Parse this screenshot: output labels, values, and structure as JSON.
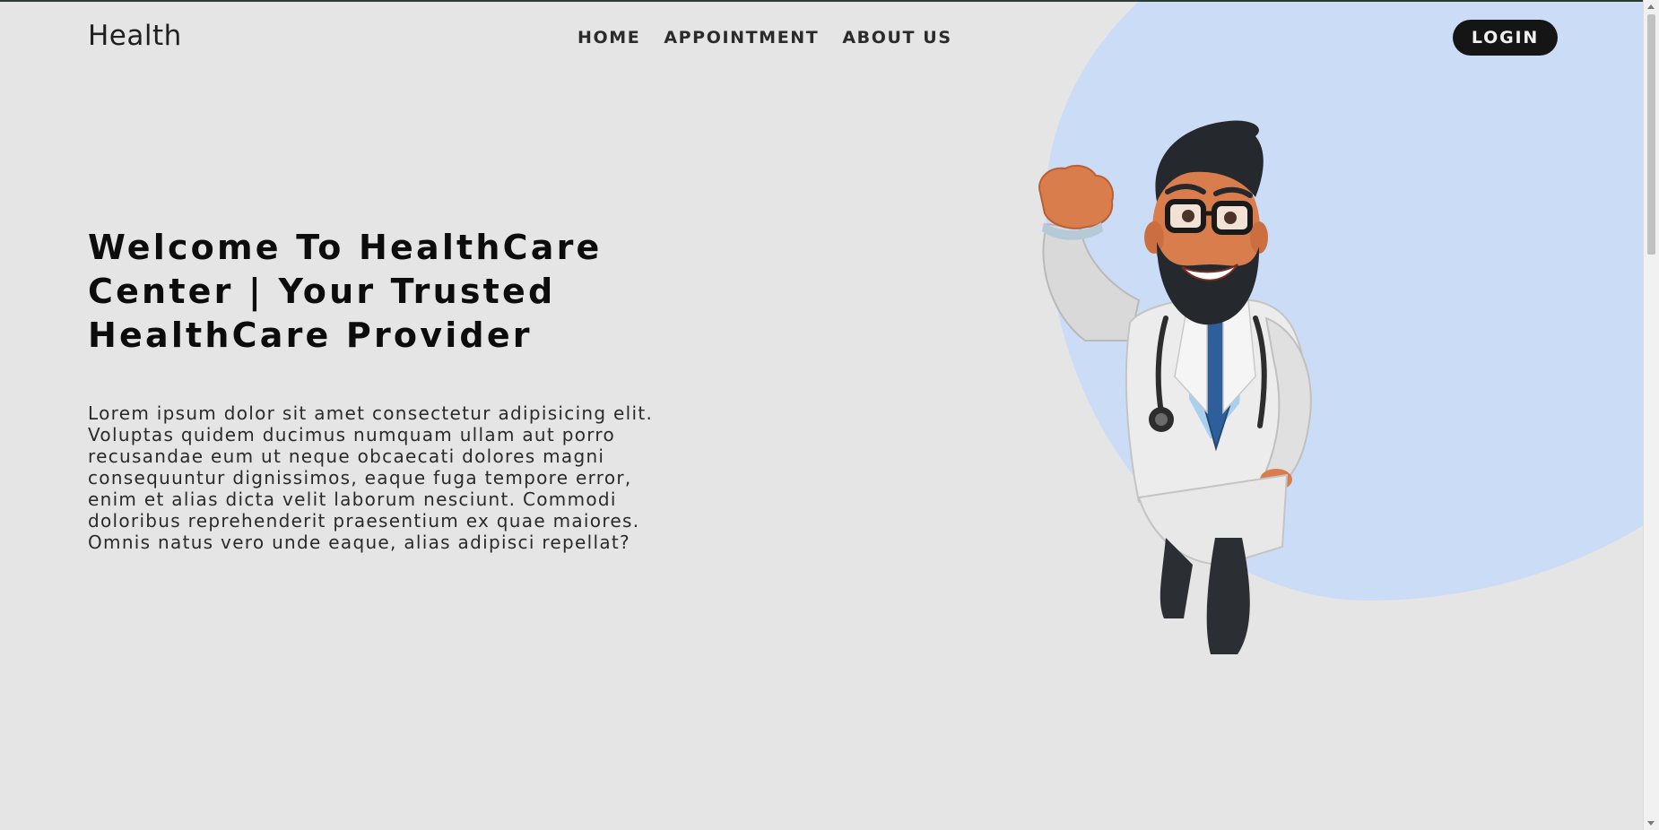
{
  "brand": {
    "name": "Health"
  },
  "nav": {
    "items": [
      {
        "label": "HOME"
      },
      {
        "label": "APPOINTMENT"
      },
      {
        "label": "ABOUT US"
      }
    ],
    "login_label": "LOGIN"
  },
  "hero": {
    "title": "Welcome To HealthCare Center | Your Trusted HealthCare Provider",
    "body": "Lorem ipsum dolor sit amet consectetur adipisicing elit. Voluptas quidem ducimus numquam ullam aut porro recusandae eum ut neque obcaecati dolores magni consequuntur dignissimos, eaque fuga tempore error, enim et alias dicta velit laborum nesciunt. Commodi doloribus reprehenderit praesentium ex quae maiores. Omnis natus vero unde eaque, alias adipisci repellat?"
  },
  "colors": {
    "background": "#e5e5e5",
    "accent_blob": "#cbdcf7",
    "login_button": "#151515",
    "text": "#0c0c0c"
  },
  "icons": {
    "illustration": "doctor-illustration",
    "scroll_up": "chevron-up-icon",
    "scroll_down": "chevron-down-icon"
  }
}
